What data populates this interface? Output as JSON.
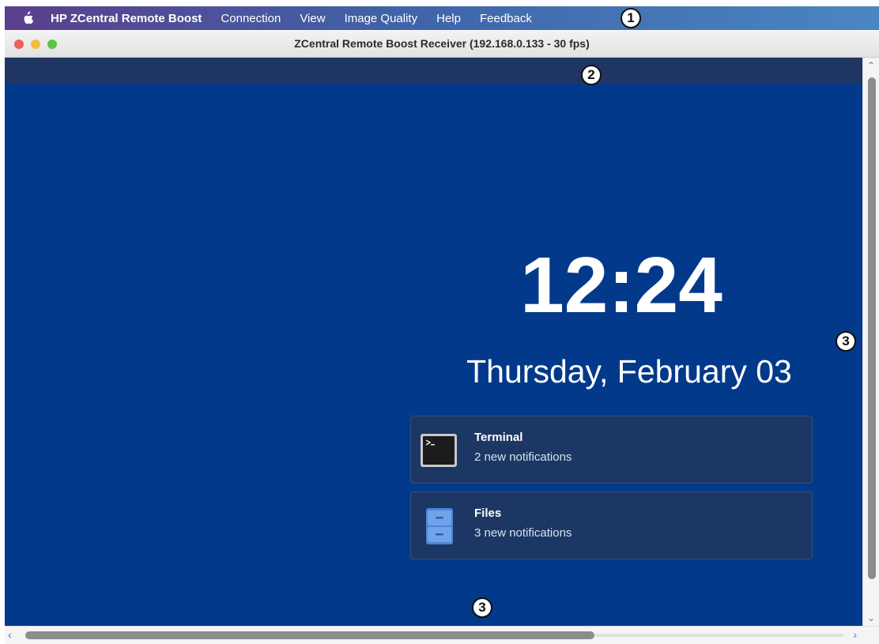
{
  "menubar": {
    "apple_icon": "apple-icon",
    "app_name": "HP ZCentral Remote Boost",
    "items": [
      "Connection",
      "View",
      "Image Quality",
      "Help",
      "Feedback"
    ]
  },
  "window": {
    "title": "ZCentral Remote Boost Receiver (192.168.0.133 - 30 fps)"
  },
  "lockscreen": {
    "time": "12:24",
    "date": "Thursday, February 03",
    "notifications": [
      {
        "app": "Terminal",
        "text": "2 new notifications",
        "icon": "terminal-icon"
      },
      {
        "app": "Files",
        "text": "3 new notifications",
        "icon": "files-icon"
      }
    ]
  },
  "callouts": [
    "1",
    "2",
    "3",
    "3"
  ],
  "colors": {
    "desktop_bg": "#03398a",
    "top_strip": "#1e3661",
    "notification_bg": "#1c3763",
    "menubar_start": "#5b3f8c",
    "menubar_end": "#4a86c2"
  }
}
